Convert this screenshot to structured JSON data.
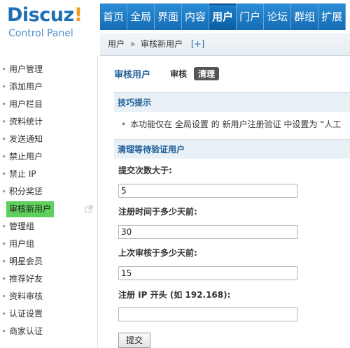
{
  "logo": {
    "main": "Discuz",
    "bang": "!",
    "sub": "Control Panel"
  },
  "topnav": {
    "tabs": [
      {
        "label": "首页",
        "active": false
      },
      {
        "label": "全局",
        "active": false
      },
      {
        "label": "界面",
        "active": false
      },
      {
        "label": "内容",
        "active": false
      },
      {
        "label": "用户",
        "active": true
      },
      {
        "label": "门户",
        "active": false
      },
      {
        "label": "论坛",
        "active": false
      },
      {
        "label": "群组",
        "active": false
      },
      {
        "label": "扩展",
        "active": false
      }
    ]
  },
  "breadcrumb": {
    "section": "用户",
    "separator": "»",
    "page": "审核新用户",
    "add": "[+]"
  },
  "sidebar": {
    "items": [
      {
        "label": "用户管理"
      },
      {
        "label": "添加用户"
      },
      {
        "label": "用户栏目"
      },
      {
        "label": "资料统计"
      },
      {
        "label": "发送通知"
      },
      {
        "label": "禁止用户"
      },
      {
        "label": "禁止 IP"
      },
      {
        "label": "积分奖惩"
      },
      {
        "label": "审核新用户",
        "active": true
      },
      {
        "label": "管理组"
      },
      {
        "label": "用户组"
      },
      {
        "label": "明星会员"
      },
      {
        "label": "推荐好友"
      },
      {
        "label": "资料审核"
      },
      {
        "label": "认证设置"
      },
      {
        "label": "商家认证"
      }
    ],
    "active_icon": "external-link-icon"
  },
  "main": {
    "title": "审核用户",
    "tab_review": "审核",
    "tab_clean": "清理",
    "tips_header": "技巧提示",
    "tip_text": "本功能仅在 全局设置 的 新用户注册验证 中设置为 “人工",
    "clean_header": "清理等待验证用户",
    "fields": [
      {
        "label": "提交次数大于:",
        "value": "5"
      },
      {
        "label": "注册时间于多少天前:",
        "value": "30"
      },
      {
        "label": "上次审核于多少天前:",
        "value": "15"
      },
      {
        "label": "注册 IP 开头 (如 192.168):",
        "value": ""
      }
    ],
    "submit_label": "提交"
  }
}
